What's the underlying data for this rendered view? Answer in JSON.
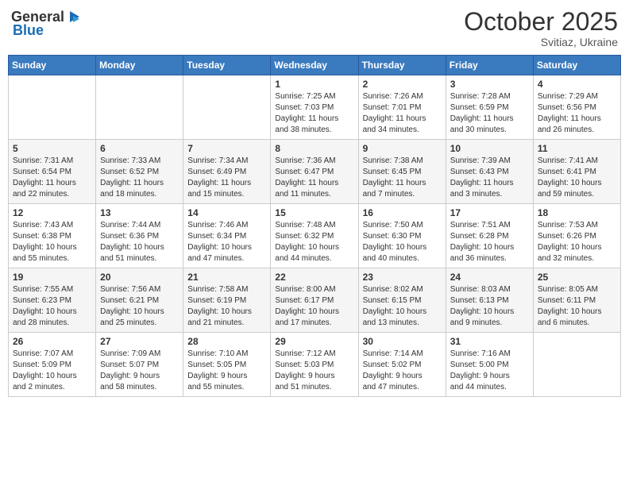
{
  "header": {
    "logo_general": "General",
    "logo_blue": "Blue",
    "month": "October 2025",
    "location": "Svitiaz, Ukraine"
  },
  "weekdays": [
    "Sunday",
    "Monday",
    "Tuesday",
    "Wednesday",
    "Thursday",
    "Friday",
    "Saturday"
  ],
  "weeks": [
    [
      {
        "day": "",
        "detail": ""
      },
      {
        "day": "",
        "detail": ""
      },
      {
        "day": "",
        "detail": ""
      },
      {
        "day": "1",
        "detail": "Sunrise: 7:25 AM\nSunset: 7:03 PM\nDaylight: 11 hours\nand 38 minutes."
      },
      {
        "day": "2",
        "detail": "Sunrise: 7:26 AM\nSunset: 7:01 PM\nDaylight: 11 hours\nand 34 minutes."
      },
      {
        "day": "3",
        "detail": "Sunrise: 7:28 AM\nSunset: 6:59 PM\nDaylight: 11 hours\nand 30 minutes."
      },
      {
        "day": "4",
        "detail": "Sunrise: 7:29 AM\nSunset: 6:56 PM\nDaylight: 11 hours\nand 26 minutes."
      }
    ],
    [
      {
        "day": "5",
        "detail": "Sunrise: 7:31 AM\nSunset: 6:54 PM\nDaylight: 11 hours\nand 22 minutes."
      },
      {
        "day": "6",
        "detail": "Sunrise: 7:33 AM\nSunset: 6:52 PM\nDaylight: 11 hours\nand 18 minutes."
      },
      {
        "day": "7",
        "detail": "Sunrise: 7:34 AM\nSunset: 6:49 PM\nDaylight: 11 hours\nand 15 minutes."
      },
      {
        "day": "8",
        "detail": "Sunrise: 7:36 AM\nSunset: 6:47 PM\nDaylight: 11 hours\nand 11 minutes."
      },
      {
        "day": "9",
        "detail": "Sunrise: 7:38 AM\nSunset: 6:45 PM\nDaylight: 11 hours\nand 7 minutes."
      },
      {
        "day": "10",
        "detail": "Sunrise: 7:39 AM\nSunset: 6:43 PM\nDaylight: 11 hours\nand 3 minutes."
      },
      {
        "day": "11",
        "detail": "Sunrise: 7:41 AM\nSunset: 6:41 PM\nDaylight: 10 hours\nand 59 minutes."
      }
    ],
    [
      {
        "day": "12",
        "detail": "Sunrise: 7:43 AM\nSunset: 6:38 PM\nDaylight: 10 hours\nand 55 minutes."
      },
      {
        "day": "13",
        "detail": "Sunrise: 7:44 AM\nSunset: 6:36 PM\nDaylight: 10 hours\nand 51 minutes."
      },
      {
        "day": "14",
        "detail": "Sunrise: 7:46 AM\nSunset: 6:34 PM\nDaylight: 10 hours\nand 47 minutes."
      },
      {
        "day": "15",
        "detail": "Sunrise: 7:48 AM\nSunset: 6:32 PM\nDaylight: 10 hours\nand 44 minutes."
      },
      {
        "day": "16",
        "detail": "Sunrise: 7:50 AM\nSunset: 6:30 PM\nDaylight: 10 hours\nand 40 minutes."
      },
      {
        "day": "17",
        "detail": "Sunrise: 7:51 AM\nSunset: 6:28 PM\nDaylight: 10 hours\nand 36 minutes."
      },
      {
        "day": "18",
        "detail": "Sunrise: 7:53 AM\nSunset: 6:26 PM\nDaylight: 10 hours\nand 32 minutes."
      }
    ],
    [
      {
        "day": "19",
        "detail": "Sunrise: 7:55 AM\nSunset: 6:23 PM\nDaylight: 10 hours\nand 28 minutes."
      },
      {
        "day": "20",
        "detail": "Sunrise: 7:56 AM\nSunset: 6:21 PM\nDaylight: 10 hours\nand 25 minutes."
      },
      {
        "day": "21",
        "detail": "Sunrise: 7:58 AM\nSunset: 6:19 PM\nDaylight: 10 hours\nand 21 minutes."
      },
      {
        "day": "22",
        "detail": "Sunrise: 8:00 AM\nSunset: 6:17 PM\nDaylight: 10 hours\nand 17 minutes."
      },
      {
        "day": "23",
        "detail": "Sunrise: 8:02 AM\nSunset: 6:15 PM\nDaylight: 10 hours\nand 13 minutes."
      },
      {
        "day": "24",
        "detail": "Sunrise: 8:03 AM\nSunset: 6:13 PM\nDaylight: 10 hours\nand 9 minutes."
      },
      {
        "day": "25",
        "detail": "Sunrise: 8:05 AM\nSunset: 6:11 PM\nDaylight: 10 hours\nand 6 minutes."
      }
    ],
    [
      {
        "day": "26",
        "detail": "Sunrise: 7:07 AM\nSunset: 5:09 PM\nDaylight: 10 hours\nand 2 minutes."
      },
      {
        "day": "27",
        "detail": "Sunrise: 7:09 AM\nSunset: 5:07 PM\nDaylight: 9 hours\nand 58 minutes."
      },
      {
        "day": "28",
        "detail": "Sunrise: 7:10 AM\nSunset: 5:05 PM\nDaylight: 9 hours\nand 55 minutes."
      },
      {
        "day": "29",
        "detail": "Sunrise: 7:12 AM\nSunset: 5:03 PM\nDaylight: 9 hours\nand 51 minutes."
      },
      {
        "day": "30",
        "detail": "Sunrise: 7:14 AM\nSunset: 5:02 PM\nDaylight: 9 hours\nand 47 minutes."
      },
      {
        "day": "31",
        "detail": "Sunrise: 7:16 AM\nSunset: 5:00 PM\nDaylight: 9 hours\nand 44 minutes."
      },
      {
        "day": "",
        "detail": ""
      }
    ]
  ]
}
